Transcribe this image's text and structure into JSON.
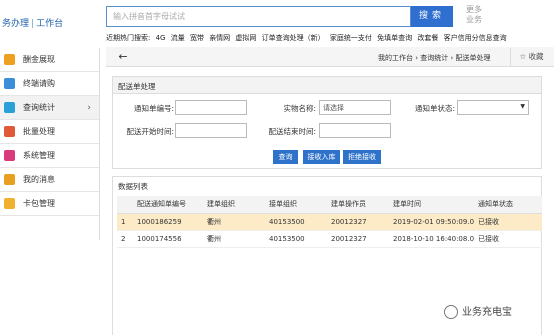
{
  "header": {
    "logo_prefix": "务办理",
    "logo_sep": "|",
    "logo_label": "工作台",
    "search_placeholder": "输入拼音首字母试试",
    "search_button": "搜索",
    "more_label": "更多业务"
  },
  "hot_search": {
    "label": "近期热门搜索:",
    "items": [
      "4G",
      "流量",
      "宽带",
      "亲情网",
      "虚拟网",
      "订单查询处理（新）",
      "家庭统一支付",
      "免填单查询",
      "改套餐",
      "客户信用分信息查询"
    ]
  },
  "sidebar": {
    "items": [
      {
        "label": "酬金展现",
        "color": "#f0a020"
      },
      {
        "label": "终端请购",
        "color": "#3a8fd8"
      },
      {
        "label": "查询统计",
        "color": "#2aa0d8"
      },
      {
        "label": "批量处理",
        "color": "#e05a3a"
      },
      {
        "label": "系统管理",
        "color": "#d83a7a"
      },
      {
        "label": "我的消息",
        "color": "#e8a020"
      },
      {
        "label": "卡包管理",
        "color": "#f0b030"
      }
    ],
    "arrow": "›"
  },
  "tabbar": {
    "back": "←",
    "breadcrumb": "我的工作台 › 查询统计 › 配送单处理",
    "favorite": "☆ 收藏"
  },
  "form": {
    "title": "配送单处理",
    "notice_no_label": "通知单编号:",
    "notice_no_value": "",
    "item_name_label": "实物名称:",
    "item_name_value": "请选择",
    "notice_status_label": "通知单状态:",
    "notice_status_value": "",
    "start_time_label": "配送开始时间:",
    "start_time_value": "",
    "end_time_label": "配送结束时间:",
    "end_time_value": "",
    "query_button": "查询",
    "receive_button": "接收入库",
    "reject_button": "拒绝接收"
  },
  "table": {
    "title": "数据列表",
    "columns": [
      "",
      "配送通知单编号",
      "建单组织",
      "接单组织",
      "建单操作员",
      "建单时间",
      "通知单状态"
    ],
    "rows": [
      [
        "1",
        "1000186259",
        "衢州",
        "40153500",
        "20012327",
        "2019-02-01 09:50:09.0",
        "已接收"
      ],
      [
        "2",
        "1000174556",
        "衢州",
        "40153500",
        "20012327",
        "2018-10-10 16:40:08.0",
        "已接收"
      ]
    ]
  },
  "watermark": "业务充电宝"
}
